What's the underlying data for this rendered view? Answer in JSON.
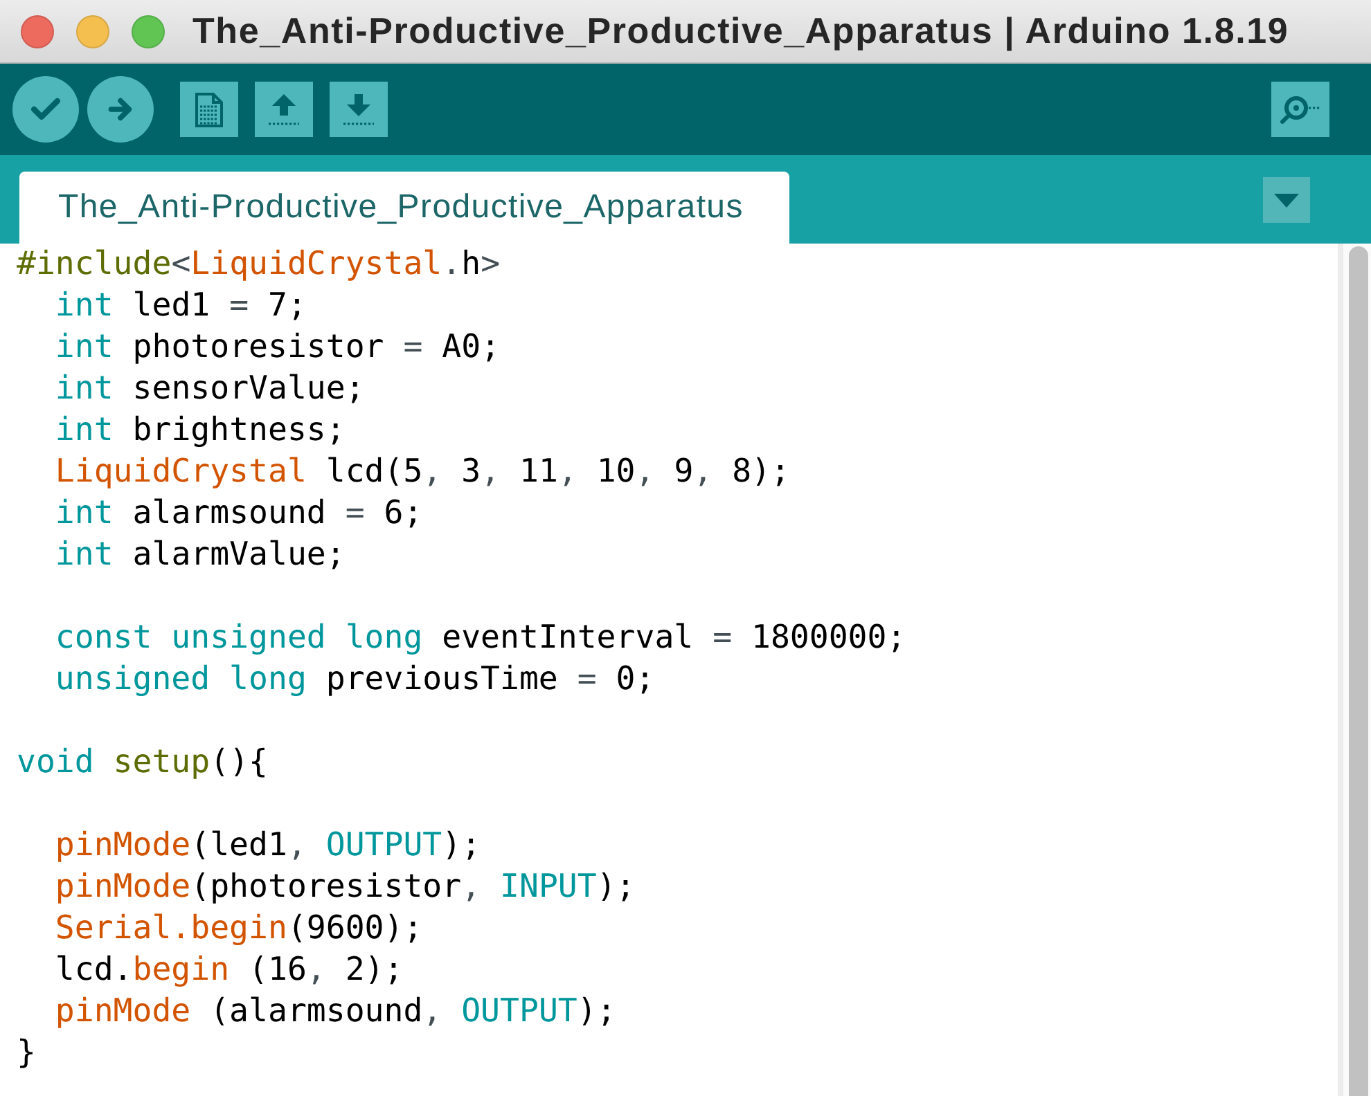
{
  "window": {
    "title": "The_Anti-Productive_Productive_Apparatus | Arduino 1.8.19"
  },
  "tabs": [
    {
      "label": "The_Anti-Productive_Productive_Apparatus",
      "selected": true
    }
  ],
  "code_lines": [
    {
      "kind": "code",
      "tokens": [
        {
          "kind": "preprocessor",
          "text": "#include"
        },
        {
          "kind": "punctuation",
          "text": "<"
        },
        {
          "kind": "function",
          "text": "LiquidCrystal"
        },
        {
          "kind": "punctuation",
          "text": "."
        },
        {
          "kind": "text",
          "text": "h"
        },
        {
          "kind": "punctuation",
          "text": ">"
        }
      ]
    },
    {
      "kind": "code",
      "tokens": [
        {
          "kind": "keyword",
          "text": "  int"
        },
        {
          "kind": "text",
          "text": " led1 "
        },
        {
          "kind": "punctuation",
          "text": "="
        },
        {
          "kind": "text",
          "text": " 7;"
        }
      ]
    },
    {
      "kind": "code",
      "tokens": [
        {
          "kind": "keyword",
          "text": "  int"
        },
        {
          "kind": "text",
          "text": " photoresistor "
        },
        {
          "kind": "punctuation",
          "text": "="
        },
        {
          "kind": "text",
          "text": " A0;"
        }
      ]
    },
    {
      "kind": "code",
      "tokens": [
        {
          "kind": "keyword",
          "text": "  int"
        },
        {
          "kind": "text",
          "text": " sensorValue;"
        }
      ]
    },
    {
      "kind": "code",
      "tokens": [
        {
          "kind": "keyword",
          "text": "  int"
        },
        {
          "kind": "text",
          "text": " brightness;"
        }
      ]
    },
    {
      "kind": "code",
      "tokens": [
        {
          "kind": "function",
          "text": "  LiquidCrystal"
        },
        {
          "kind": "text",
          "text": " lcd(5"
        },
        {
          "kind": "punctuation",
          "text": ","
        },
        {
          "kind": "text",
          "text": " 3"
        },
        {
          "kind": "punctuation",
          "text": ","
        },
        {
          "kind": "text",
          "text": " 11"
        },
        {
          "kind": "punctuation",
          "text": ","
        },
        {
          "kind": "text",
          "text": " 10"
        },
        {
          "kind": "punctuation",
          "text": ","
        },
        {
          "kind": "text",
          "text": " 9"
        },
        {
          "kind": "punctuation",
          "text": ","
        },
        {
          "kind": "text",
          "text": " 8);"
        }
      ]
    },
    {
      "kind": "code",
      "tokens": [
        {
          "kind": "keyword",
          "text": "  int"
        },
        {
          "kind": "text",
          "text": " alarmsound "
        },
        {
          "kind": "punctuation",
          "text": "="
        },
        {
          "kind": "text",
          "text": " 6;"
        }
      ]
    },
    {
      "kind": "code",
      "tokens": [
        {
          "kind": "keyword",
          "text": "  int"
        },
        {
          "kind": "text",
          "text": " alarmValue;"
        }
      ]
    },
    {
      "kind": "blank"
    },
    {
      "kind": "code",
      "tokens": [
        {
          "kind": "keyword",
          "text": "  const unsigned long"
        },
        {
          "kind": "text",
          "text": " eventInterval "
        },
        {
          "kind": "punctuation",
          "text": "="
        },
        {
          "kind": "text",
          "text": " 1800000;"
        }
      ]
    },
    {
      "kind": "code",
      "tokens": [
        {
          "kind": "keyword",
          "text": "  unsigned long"
        },
        {
          "kind": "text",
          "text": " previousTime "
        },
        {
          "kind": "punctuation",
          "text": "="
        },
        {
          "kind": "text",
          "text": " 0;"
        }
      ]
    },
    {
      "kind": "blank"
    },
    {
      "kind": "code",
      "tokens": [
        {
          "kind": "keyword",
          "text": "void"
        },
        {
          "kind": "preprocessor",
          "text": " setup"
        },
        {
          "kind": "text",
          "text": "(){"
        }
      ]
    },
    {
      "kind": "blank"
    },
    {
      "kind": "code",
      "tokens": [
        {
          "kind": "function",
          "text": "  pinMode"
        },
        {
          "kind": "text",
          "text": "(led1"
        },
        {
          "kind": "punctuation",
          "text": ","
        },
        {
          "kind": "keyword",
          "text": " OUTPUT"
        },
        {
          "kind": "text",
          "text": ");"
        }
      ]
    },
    {
      "kind": "code",
      "tokens": [
        {
          "kind": "function",
          "text": "  pinMode"
        },
        {
          "kind": "text",
          "text": "(photoresistor"
        },
        {
          "kind": "punctuation",
          "text": ","
        },
        {
          "kind": "keyword",
          "text": " INPUT"
        },
        {
          "kind": "text",
          "text": ");"
        }
      ]
    },
    {
      "kind": "code",
      "tokens": [
        {
          "kind": "function",
          "text": "  Serial.begin"
        },
        {
          "kind": "text",
          "text": "(9600);"
        }
      ]
    },
    {
      "kind": "code",
      "tokens": [
        {
          "kind": "text",
          "text": "  lcd."
        },
        {
          "kind": "function",
          "text": "begin"
        },
        {
          "kind": "text",
          "text": " (16"
        },
        {
          "kind": "punctuation",
          "text": ","
        },
        {
          "kind": "text",
          "text": " 2);"
        }
      ]
    },
    {
      "kind": "code",
      "tokens": [
        {
          "kind": "function",
          "text": "  pinMode"
        },
        {
          "kind": "text",
          "text": " (alarmsound"
        },
        {
          "kind": "punctuation",
          "text": ","
        },
        {
          "kind": "keyword",
          "text": " OUTPUT"
        },
        {
          "kind": "text",
          "text": ");"
        }
      ]
    },
    {
      "kind": "code",
      "tokens": [
        {
          "kind": "text",
          "text": "}"
        }
      ]
    }
  ]
}
